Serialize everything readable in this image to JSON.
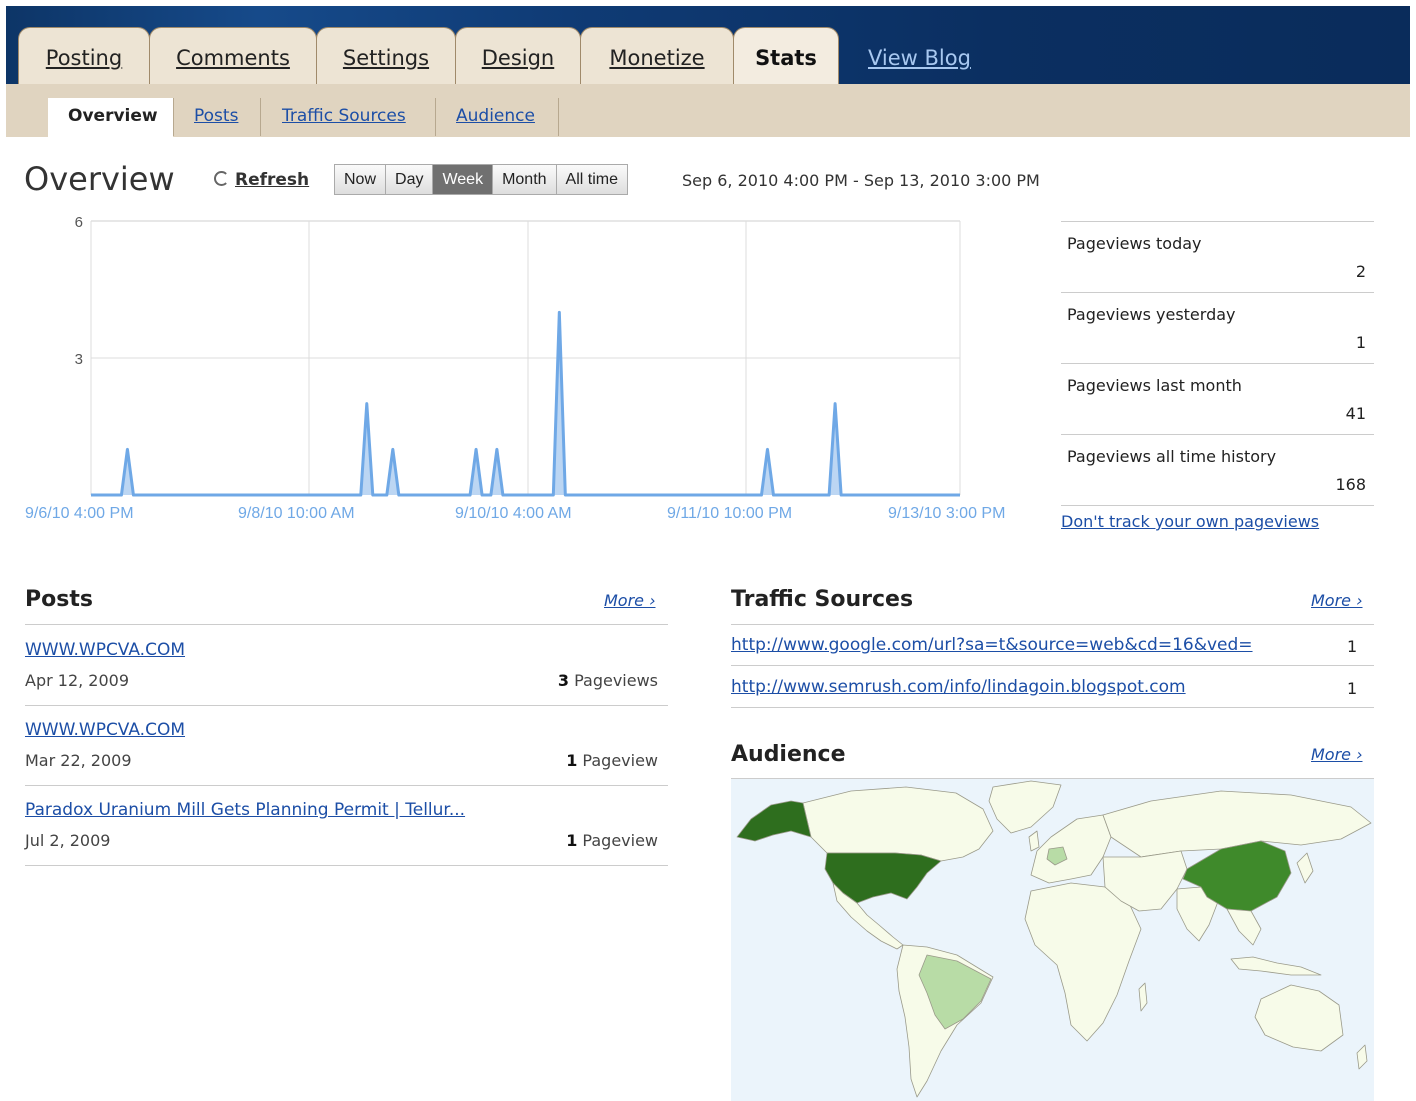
{
  "tabs": [
    {
      "label": "Posting"
    },
    {
      "label": "Comments"
    },
    {
      "label": "Settings"
    },
    {
      "label": "Design"
    },
    {
      "label": "Monetize"
    },
    {
      "label": "Stats",
      "active": true
    }
  ],
  "view_blog": "View Blog",
  "subnav": {
    "items": [
      "Overview",
      "Posts",
      "Traffic Sources",
      "Audience"
    ],
    "current": "Overview"
  },
  "overview": {
    "title": "Overview",
    "refresh": "Refresh",
    "range_buttons": [
      "Now",
      "Day",
      "Week",
      "Month",
      "All time"
    ],
    "range_selected": "Week",
    "date_range": "Sep 6, 2010 4:00 PM - Sep 13, 2010 3:00 PM"
  },
  "chart_data": {
    "type": "area",
    "x_labels": [
      "9/6/10 4:00 PM",
      "9/8/10 10:00 AM",
      "9/10/10 4:00 AM",
      "9/11/10 10:00 PM",
      "9/13/10 3:00 PM"
    ],
    "y_ticks": [
      "6",
      "3"
    ],
    "ylim": [
      0,
      6
    ],
    "peaks": [
      {
        "x": "~9/6/10 11:00 PM",
        "y": 1
      },
      {
        "x": "~9/8/10 9:00 PM",
        "y": 2
      },
      {
        "x": "~9/9/10 2:00 AM",
        "y": 1
      },
      {
        "x": "~9/9/10 6:00 PM",
        "y": 1
      },
      {
        "x": "~9/9/10 10:00 PM",
        "y": 1
      },
      {
        "x": "~9/10/10 10:00 AM",
        "y": 4
      },
      {
        "x": "~9/12/10 2:00 AM",
        "y": 1
      },
      {
        "x": "~9/12/10 3:00 PM",
        "y": 2
      }
    ],
    "color": "#6fa8e6",
    "grid": true
  },
  "pageviews": [
    {
      "label": "Pageviews today",
      "value": "2"
    },
    {
      "label": "Pageviews yesterday",
      "value": "1"
    },
    {
      "label": "Pageviews last month",
      "value": "41"
    },
    {
      "label": "Pageviews all time history",
      "value": "168"
    }
  ],
  "dont_track": "Don't track your own pageviews",
  "posts": {
    "title": "Posts",
    "more": "More ›",
    "rows": [
      {
        "title": "WWW.WPCVA.COM",
        "date": "Apr 12, 2009",
        "count": "3",
        "unit": "Pageviews"
      },
      {
        "title": "WWW.WPCVA.COM",
        "date": "Mar 22, 2009",
        "count": "1",
        "unit": "Pageview"
      },
      {
        "title": "Paradox Uranium Mill Gets Planning Permit | Tellur...",
        "date": "Jul 2, 2009",
        "count": "1",
        "unit": "Pageview"
      }
    ]
  },
  "traffic": {
    "title": "Traffic Sources",
    "more": "More ›",
    "rows": [
      {
        "url": "http://www.google.com/url?sa=t&source=web&cd=16&ved=",
        "count": "1"
      },
      {
        "url": "http://www.semrush.com/info/lindagoin.blogspot.com",
        "count": "1"
      }
    ]
  },
  "audience": {
    "title": "Audience",
    "more": "More ›",
    "colors": {
      "ocean": "#ebf4fb",
      "land": "#f7fbe9",
      "high": "#2e6e1e",
      "mid": "#3f8a2b",
      "low": "#b8dca6"
    }
  }
}
